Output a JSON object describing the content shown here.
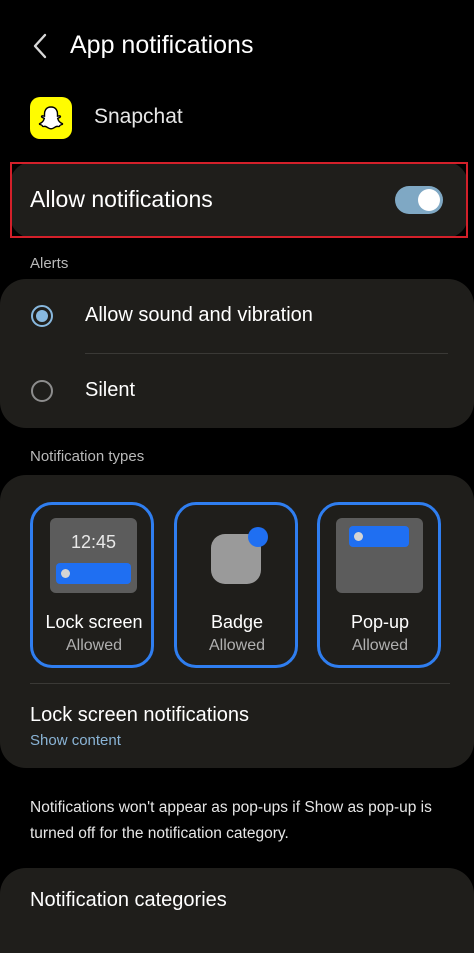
{
  "header": {
    "title": "App notifications"
  },
  "app": {
    "name": "Snapchat",
    "icon": "snapchat-ghost-icon",
    "icon_color": "#FFFC00"
  },
  "allow_notifications": {
    "label": "Allow notifications",
    "enabled": true,
    "highlight_color": "#d3202a"
  },
  "alerts": {
    "header": "Alerts",
    "options": [
      {
        "label": "Allow sound and vibration",
        "selected": true
      },
      {
        "label": "Silent",
        "selected": false
      }
    ]
  },
  "notification_types": {
    "header": "Notification types",
    "tiles": [
      {
        "name": "Lock screen",
        "status": "Allowed",
        "preview_time": "12:45"
      },
      {
        "name": "Badge",
        "status": "Allowed"
      },
      {
        "name": "Pop-up",
        "status": "Allowed"
      }
    ],
    "accent_color": "#2f7ef0"
  },
  "lock_screen_notifications": {
    "title": "Lock screen notifications",
    "value": "Show content"
  },
  "info_text": "Notifications won't appear as pop-ups if Show as pop-up is turned off for the notification category.",
  "notification_categories": {
    "label": "Notification categories"
  }
}
